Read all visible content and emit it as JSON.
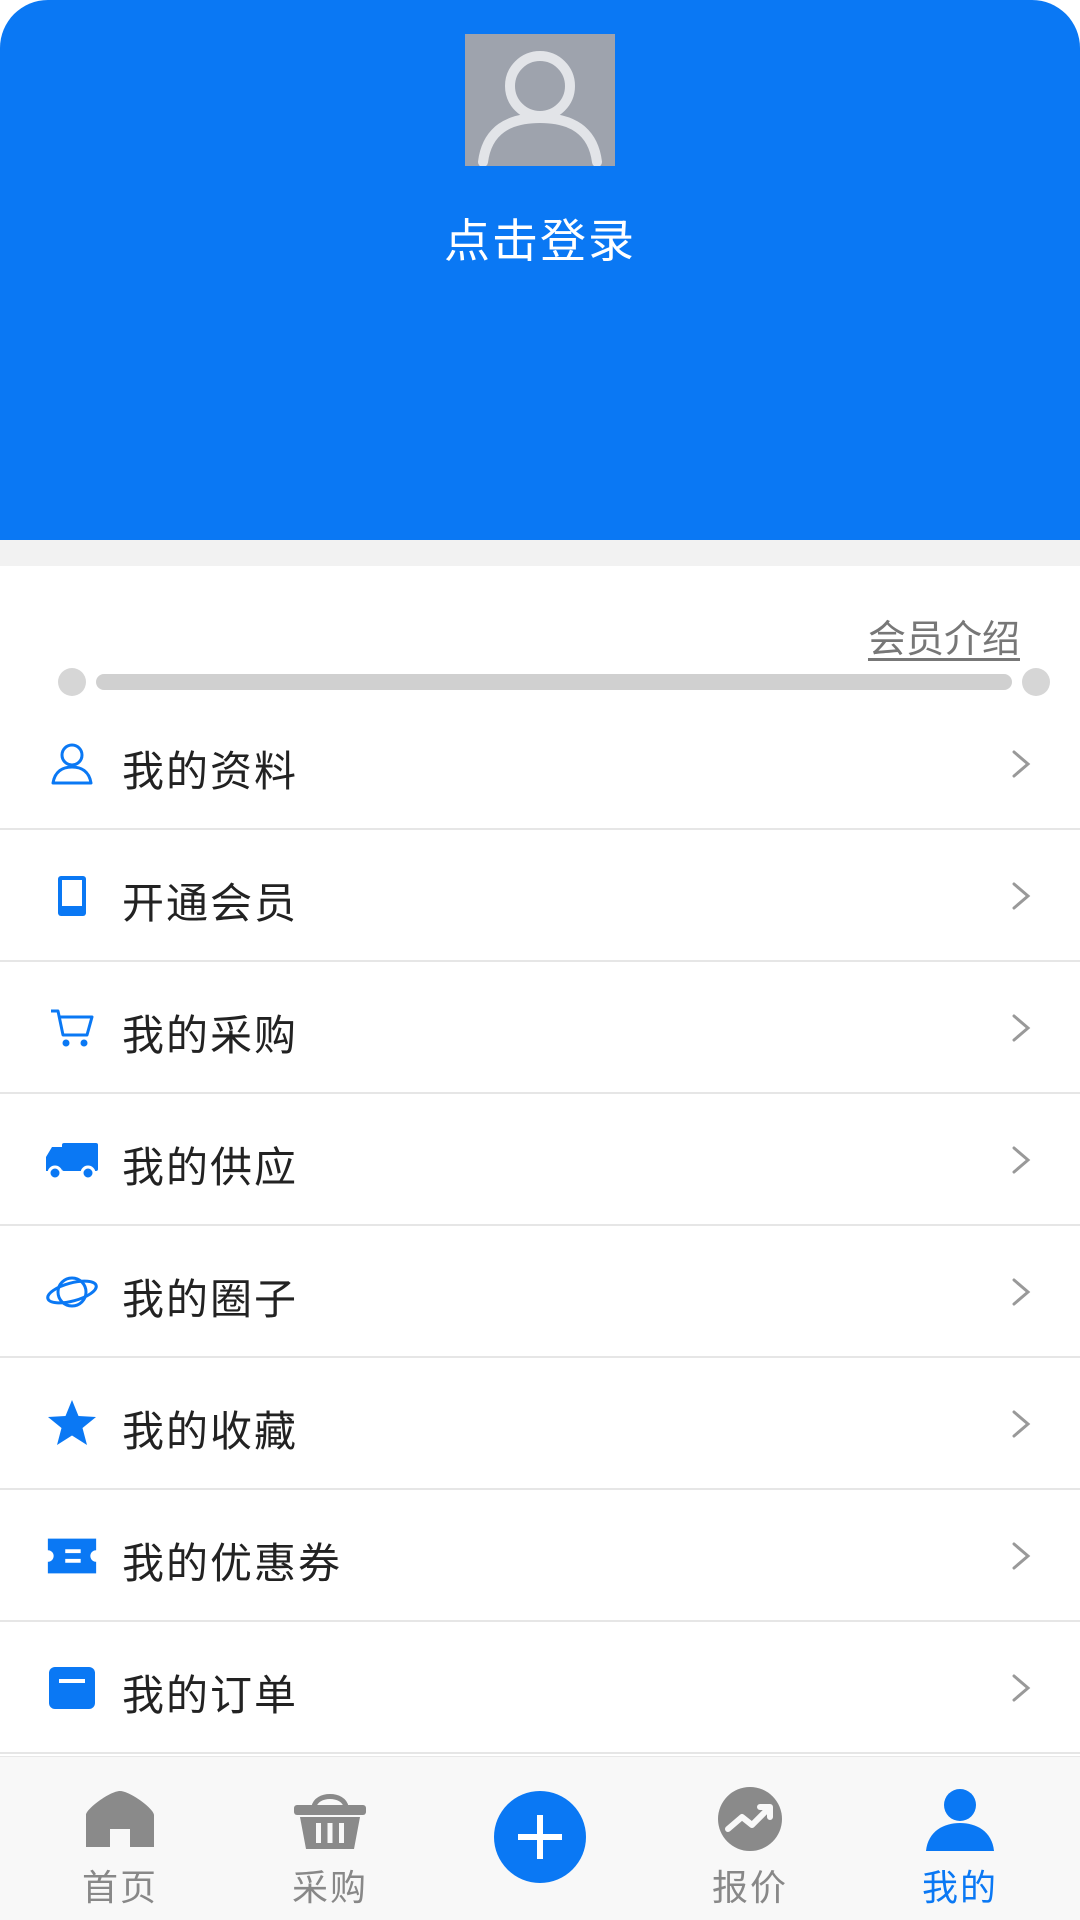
{
  "header": {
    "login_text": "点击登录"
  },
  "member": {
    "intro_link": "会员介绍",
    "progress": 0
  },
  "menu": {
    "items": [
      {
        "label": "我的资料",
        "icon": "user-outline-icon"
      },
      {
        "label": "开通会员",
        "icon": "tablet-icon"
      },
      {
        "label": "我的采购",
        "icon": "cart-icon"
      },
      {
        "label": "我的供应",
        "icon": "truck-icon"
      },
      {
        "label": "我的圈子",
        "icon": "planet-icon"
      },
      {
        "label": "我的收藏",
        "icon": "star-icon"
      },
      {
        "label": "我的优惠券",
        "icon": "coupon-icon"
      },
      {
        "label": "我的订单",
        "icon": "order-icon"
      }
    ]
  },
  "tabbar": {
    "tabs": [
      {
        "label": "首页",
        "icon": "home-icon"
      },
      {
        "label": "采购",
        "icon": "basket-icon"
      },
      {
        "label": "",
        "icon": "plus-icon"
      },
      {
        "label": "报价",
        "icon": "trend-icon"
      },
      {
        "label": "我的",
        "icon": "person-icon"
      }
    ],
    "active_index": 4
  },
  "colors": {
    "brand": "#0a78f4",
    "tab_inactive": "#888888"
  }
}
